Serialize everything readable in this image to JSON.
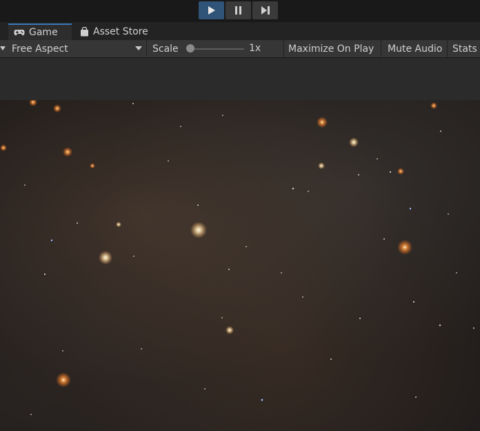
{
  "tabs": {
    "game_label": "Game",
    "store_label": "Asset Store"
  },
  "game_toolbar": {
    "aspect_label": "Free Aspect",
    "scale_label": "Scale",
    "scale_value": "1x",
    "maximize_label": "Maximize On Play",
    "mute_label": "Mute Audio",
    "stats_label": "Stats"
  },
  "colors": {
    "accent": "#2f5478",
    "tab_highlight": "#3a79bb"
  }
}
